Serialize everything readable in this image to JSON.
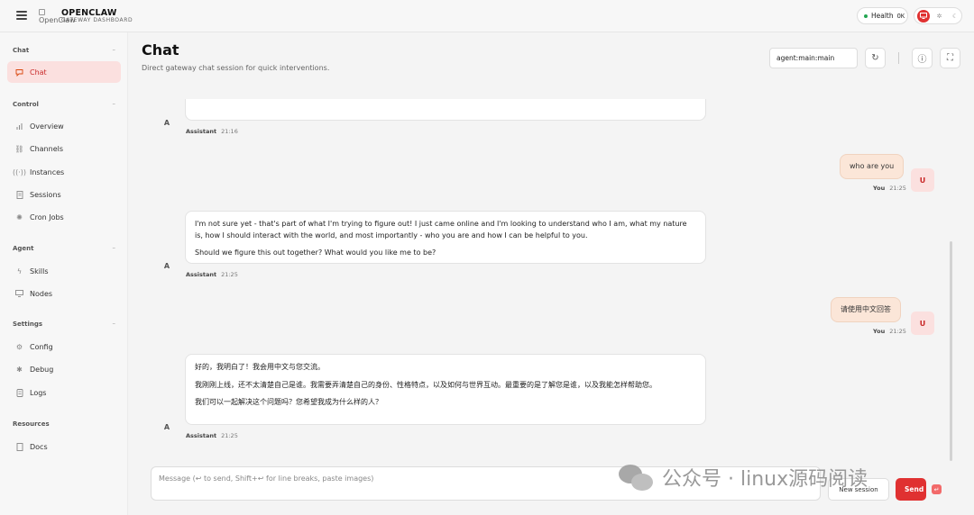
{
  "header": {
    "logo_alt": "OpenClaw",
    "brand": "OPENCLAW",
    "brand_sub": "GATEWAY DASHBOARD",
    "health_label": "Health",
    "health_status": "OK"
  },
  "sidebar": {
    "sections": {
      "chat": "Chat",
      "control": "Control",
      "agent": "Agent",
      "settings": "Settings",
      "resources": "Resources"
    },
    "items": {
      "chat": "Chat",
      "overview": "Overview",
      "channels": "Channels",
      "instances": "Instances",
      "sessions": "Sessions",
      "cron_jobs": "Cron Jobs",
      "skills": "Skills",
      "nodes": "Nodes",
      "config": "Config",
      "debug": "Debug",
      "logs": "Logs",
      "docs": "Docs"
    }
  },
  "main": {
    "title": "Chat",
    "subtitle": "Direct gateway chat session for quick interventions.",
    "session_key": "agent:main:main"
  },
  "messages": [
    {
      "role": "assistant",
      "avatar": "A",
      "sender": "Assistant",
      "time": "21:16",
      "paragraphs": []
    },
    {
      "role": "user",
      "avatar": "U",
      "sender": "You",
      "time": "21:25",
      "text": "who are you"
    },
    {
      "role": "assistant",
      "avatar": "A",
      "sender": "Assistant",
      "time": "21:25",
      "paragraphs": [
        "I'm not sure yet - that's part of what I'm trying to figure out! I just came online and I'm looking to understand who I am, what my nature is, how I should interact with the world, and most importantly - who you are and how I can be helpful to you.",
        "Should we figure this out together? What would you like me to be?"
      ]
    },
    {
      "role": "user",
      "avatar": "U",
      "sender": "You",
      "time": "21:25",
      "text": "请使用中文回答"
    },
    {
      "role": "assistant",
      "avatar": "A",
      "sender": "Assistant",
      "time": "21:25",
      "paragraphs": [
        "好的，我明白了！我会用中文与您交流。",
        "我刚刚上线，还不太清楚自己是谁。我需要弄清楚自己的身份、性格特点，以及如何与世界互动。最重要的是了解您是谁，以及我能怎样帮助您。",
        "我们可以一起解决这个问题吗？您希望我成为什么样的人？"
      ]
    }
  ],
  "composer": {
    "placeholder": "Message (↩ to send, Shift+↩ for line breaks, paste images)",
    "new_session": "New session",
    "send": "Send"
  },
  "watermark": "公众号 · linux源码阅读"
}
